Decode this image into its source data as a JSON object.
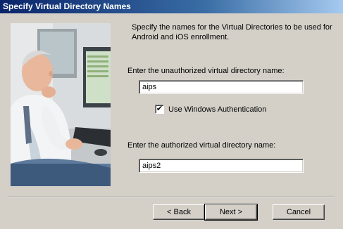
{
  "window": {
    "title": "Specify Virtual Directory Names"
  },
  "description": "Specify the names for the Virtual Directories to be used for Android and iOS enrollment.",
  "unauthorized": {
    "label": "Enter the unauthorized virtual directory name:",
    "value": "aips"
  },
  "auth_checkbox": {
    "label": "Use Windows Authentication",
    "checked": true
  },
  "authorized": {
    "label": "Enter the authorized virtual directory name:",
    "value": "aips2"
  },
  "buttons": {
    "back": "< Back",
    "next": "Next >",
    "cancel": "Cancel"
  },
  "colors": {
    "titlebar_start": "#0a246a",
    "titlebar_end": "#a6caf0",
    "dialog_bg": "#d4d0c8"
  }
}
